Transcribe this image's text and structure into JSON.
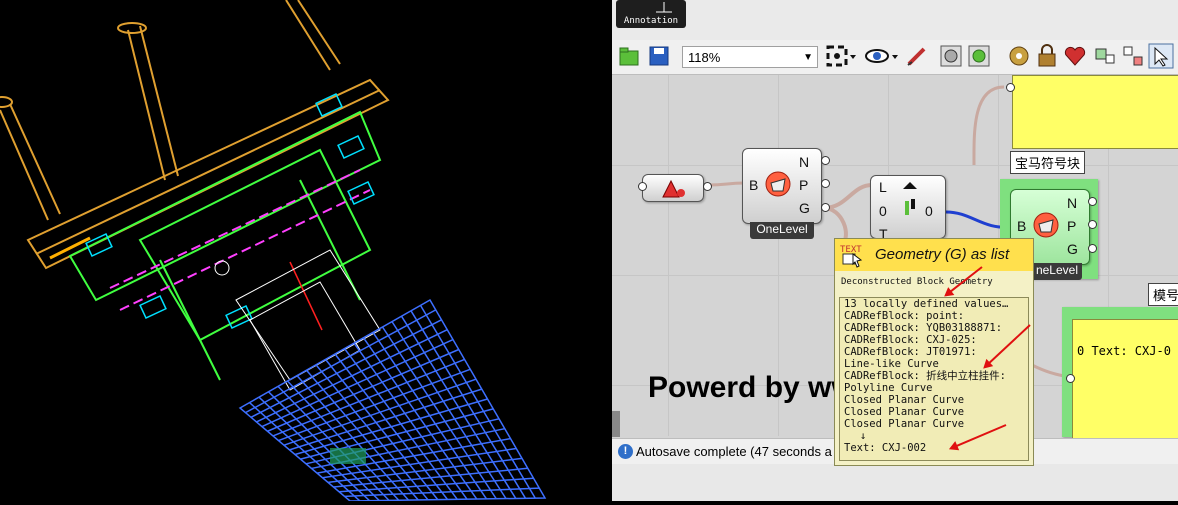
{
  "annotation_label": "Annotation",
  "toolbar": {
    "zoom": "118%"
  },
  "components": {
    "onelevel1": {
      "input": "B",
      "outputs": [
        "N",
        "P",
        "G"
      ],
      "nickname": "OneLevel"
    },
    "slider": {
      "labels": [
        "L",
        "0",
        "0",
        "T"
      ]
    },
    "onelevel2": {
      "input": "B",
      "outputs": [
        "N",
        "P",
        "G"
      ],
      "nickname": "neLevel",
      "bubble": "宝马符号块"
    },
    "panel_right": {
      "bubble": "模号",
      "line": "0 Text: CXJ-0"
    }
  },
  "watermark": "Powerd by ww",
  "status": {
    "text": "Autosave complete (47 seconds a"
  },
  "tooltip": {
    "title": "Geometry (G) as list",
    "subtitle": "Deconstructed Block Geometry",
    "lines": [
      "13 locally defined values…",
      "CADRefBlock: point:",
      "CADRefBlock: YQB03188871:",
      "CADRefBlock: CXJ-025:",
      "CADRefBlock: JT01971:",
      "Line-like Curve",
      "CADRefBlock: 折线中立柱挂件:",
      "Polyline Curve",
      "Closed Planar Curve",
      "Closed Planar Curve",
      "Closed Planar Curve",
      "↓",
      "Text: CXJ-002"
    ]
  }
}
